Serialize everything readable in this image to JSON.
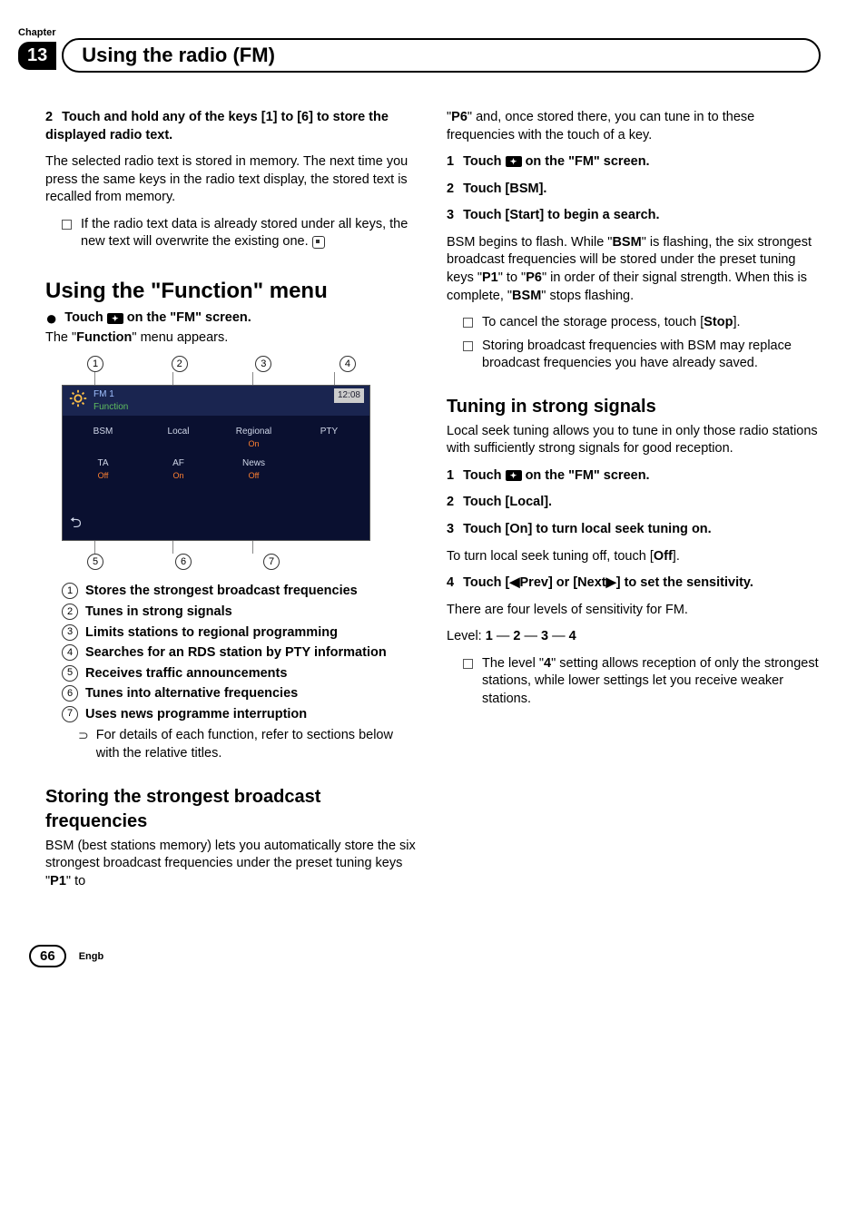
{
  "chapter": {
    "label": "Chapter",
    "number": "13",
    "title": "Using the radio (FM)"
  },
  "left": {
    "step2": {
      "num": "2",
      "head": "Touch and hold any of the keys [1] to [6] to store the displayed radio text.",
      "body": "The selected radio text is stored in memory. The next time you press the same keys in the radio text display, the stored text is recalled from memory.",
      "note": "If the radio text data is already stored under all keys, the new text will overwrite the existing one."
    },
    "section_function": {
      "title": "Using the \"Function\" menu",
      "bullet": "Touch",
      "bullet_suffix": "on the \"FM\" screen.",
      "body": "The \"Function\" menu appears."
    },
    "screen": {
      "band": "FM 1",
      "mode": "Function",
      "time": "12:08",
      "cells": {
        "bsm": "BSM",
        "local": "Local",
        "regional": "Regional",
        "regional_sub": "On",
        "pty": "PTY",
        "ta": "TA",
        "ta_sub": "Off",
        "af": "AF",
        "af_sub": "On",
        "news": "News",
        "news_sub": "Off"
      }
    },
    "callouts_top": [
      "1",
      "2",
      "3",
      "4"
    ],
    "callouts_bottom": [
      "5",
      "6",
      "7"
    ],
    "enum": {
      "i1": "Stores the strongest broadcast frequencies",
      "i2": "Tunes in strong signals",
      "i3": "Limits stations to regional programming",
      "i4": "Searches for an RDS station by PTY information",
      "i5": "Receives traffic announcements",
      "i6": "Tunes into alternative frequencies",
      "i7": "Uses news programme interruption",
      "note": "For details of each function, refer to sections below with the relative titles."
    },
    "section_bsm": {
      "title": "Storing the strongest broadcast frequencies",
      "body": "BSM (best stations memory) lets you automatically store the six strongest broadcast frequencies under the preset tuning keys \"P1\" to"
    }
  },
  "right": {
    "cont": {
      "p1": "\"P6\" and, once stored there, you can tune in to these frequencies with the touch of a key."
    },
    "s1": {
      "num": "1",
      "pre": "Touch",
      "post": "on the \"FM\" screen."
    },
    "s2": {
      "num": "2",
      "text": "Touch [BSM]."
    },
    "s3": {
      "num": "3",
      "head": "Touch [Start] to begin a search.",
      "body_a": "BSM begins to flash. While \"",
      "body_b": "\" is flashing, the six strongest broadcast frequencies will be stored under the preset tuning keys \"",
      "body_c": "\" to \"",
      "body_d": "\" in order of their signal strength. When this is complete, \"",
      "body_e": "\" stops flashing.",
      "bsm": "BSM",
      "p1": "P1",
      "p6": "P6",
      "note1_a": "To cancel the storage process, touch [",
      "note1_b": "].",
      "stop": "Stop",
      "note2": "Storing broadcast frequencies with BSM may replace broadcast frequencies you have already saved."
    },
    "tuning": {
      "title": "Tuning in strong signals",
      "intro": "Local seek tuning allows you to tune in only those radio stations with sufficiently strong signals for good reception.",
      "t1": {
        "num": "1",
        "pre": "Touch",
        "post": "on the \"FM\" screen."
      },
      "t2": {
        "num": "2",
        "text": "Touch [Local]."
      },
      "t3": {
        "num": "3",
        "head": "Touch [On] to turn local seek tuning on.",
        "body_a": "To turn local seek tuning off, touch [",
        "off": "Off",
        "body_b": "]."
      },
      "t4": {
        "num": "4",
        "head": "Touch [◀Prev] or [Next▶] to set the sensitivity.",
        "body": "There are four levels of sensitivity for FM.",
        "level_label": "Level: ",
        "l1": "1",
        "l2": "2",
        "l3": "3",
        "l4": "4",
        "dash": " — ",
        "note_a": "The level \"",
        "note_b": "\" setting allows reception of only the strongest stations, while lower settings let you receive weaker stations.",
        "four": "4"
      }
    }
  },
  "footer": {
    "page": "66",
    "lang": "Engb"
  }
}
